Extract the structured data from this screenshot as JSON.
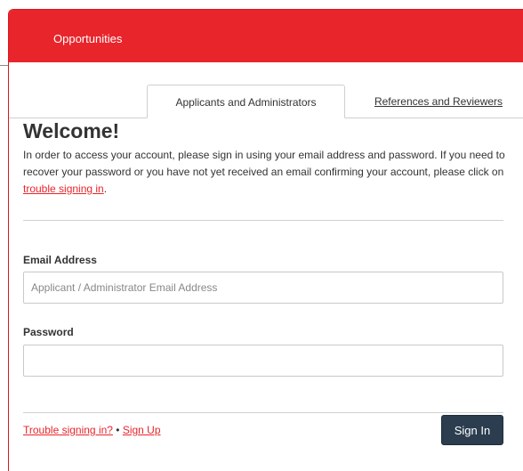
{
  "header": {
    "nav_label": "Opportunities"
  },
  "tabs": [
    {
      "label": "Applicants and Administrators",
      "active": true
    },
    {
      "label": "References and Reviewers",
      "active": false
    }
  ],
  "welcome": {
    "title": "Welcome!",
    "intro_text": "In order to access your account, please sign in using your email address and password. If you need to recover your password or you have not yet received an email confirming your account, please click on ",
    "intro_link": "trouble signing in",
    "intro_end": "."
  },
  "form": {
    "email_label": "Email Address",
    "email_placeholder": "Applicant / Administrator Email Address",
    "email_value": "",
    "password_label": "Password",
    "password_value": ""
  },
  "footer": {
    "trouble_link": "Trouble signing in?",
    "separator": " • ",
    "signup_link": "Sign Up",
    "signin_label": "Sign In"
  },
  "colors": {
    "brand_red": "#e8252b",
    "button_dark": "#2b3d4f"
  }
}
